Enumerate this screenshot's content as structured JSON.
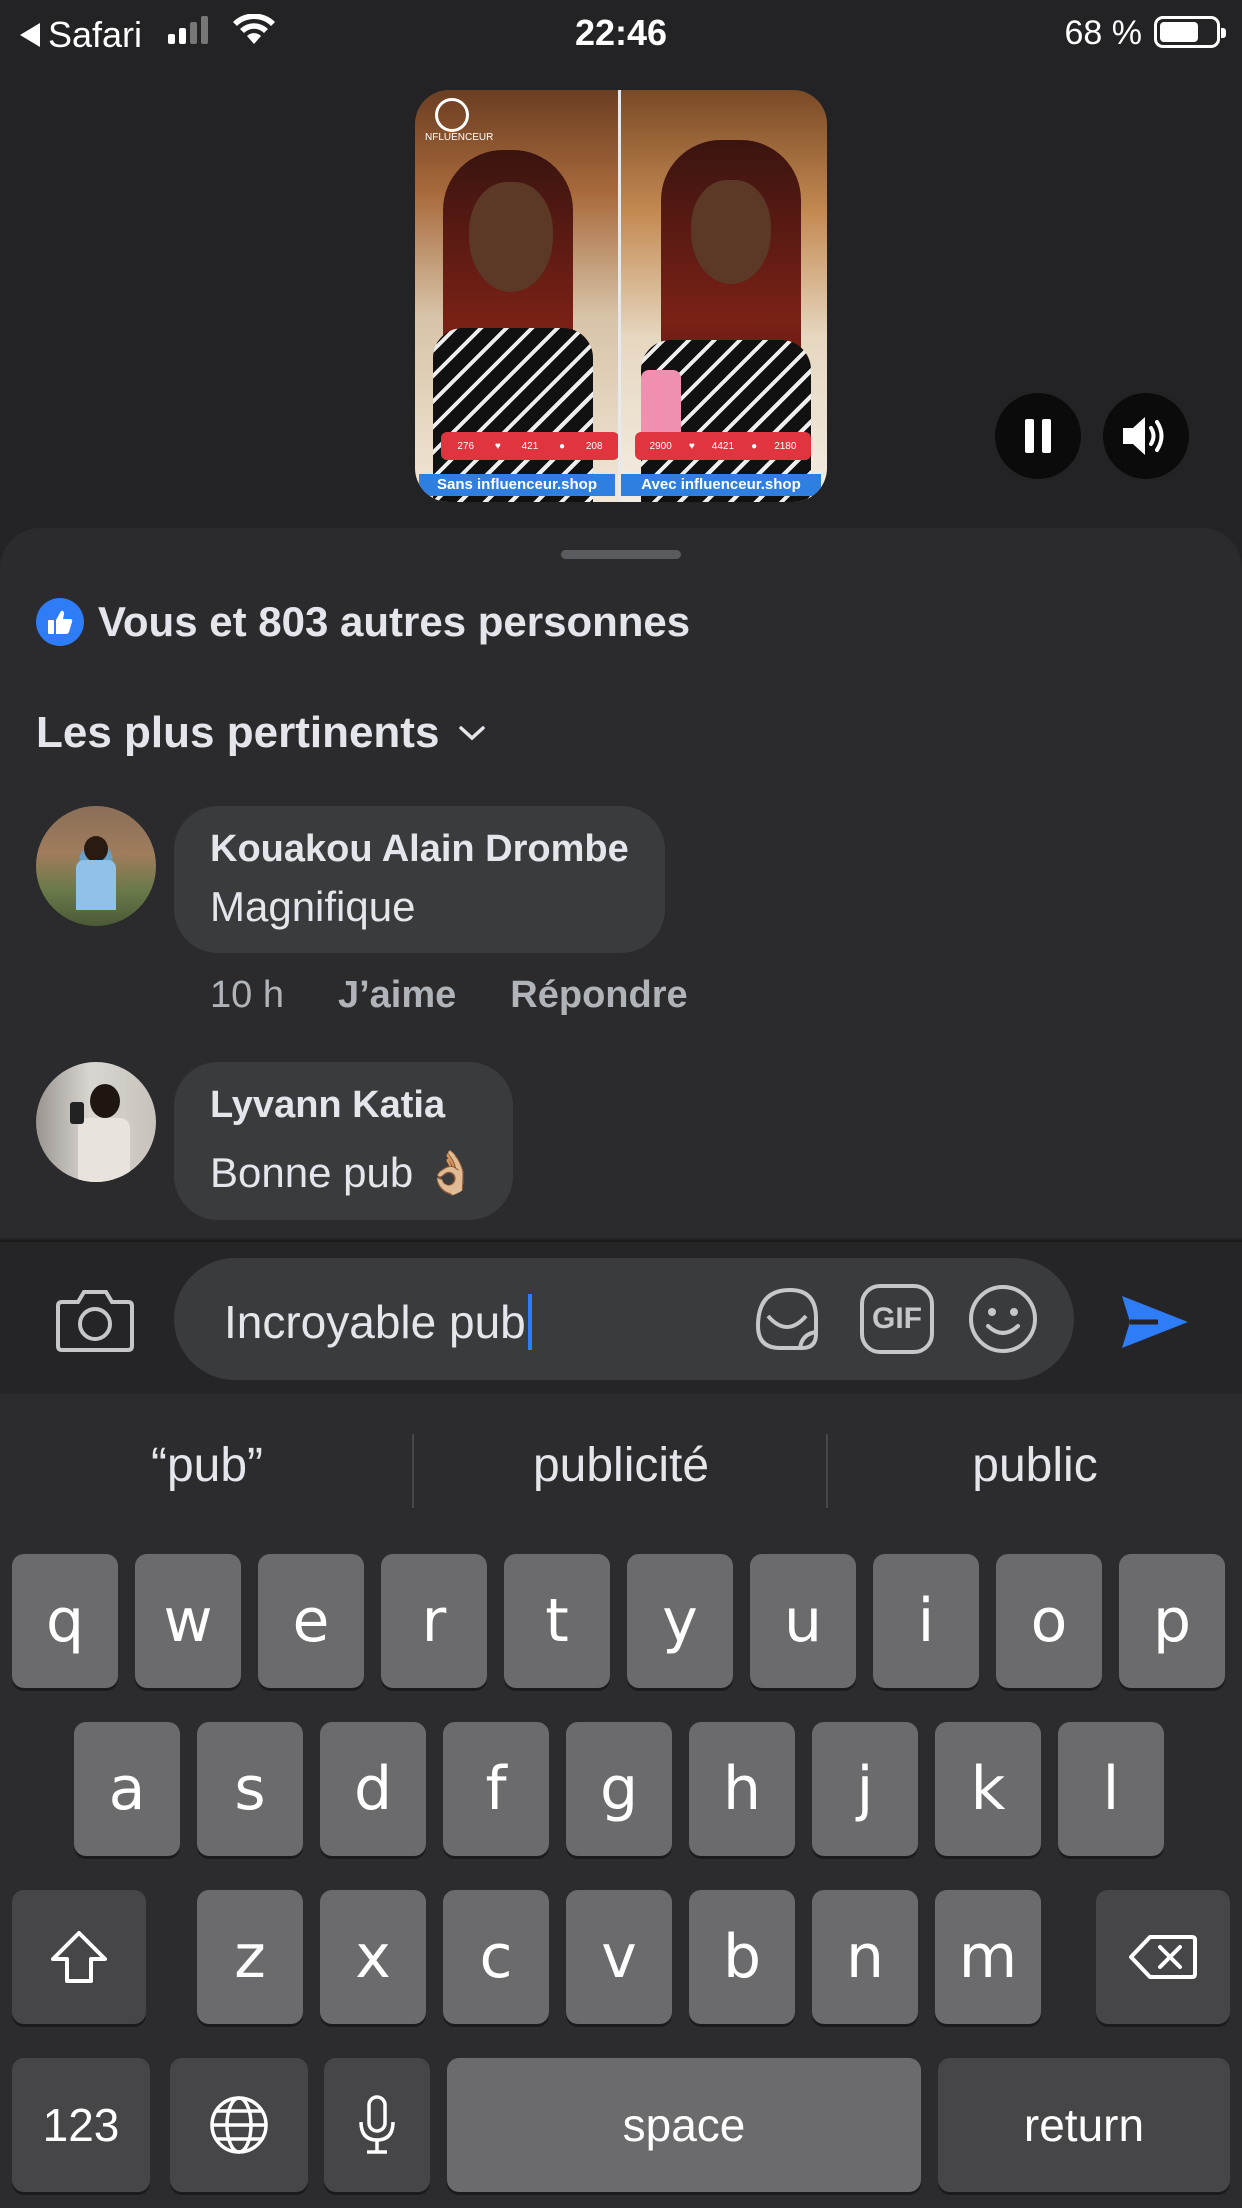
{
  "status_bar": {
    "back_app": "Safari",
    "time": "22:46",
    "battery_percent": "68 %",
    "battery_level": 0.68
  },
  "video": {
    "brand": "NFLUENCEUR",
    "left_caption": "Sans influenceur.shop",
    "right_caption": "Avec influenceur.shop",
    "left_stats": [
      "276",
      "421",
      "208"
    ],
    "right_stats": [
      "2900",
      "4421",
      "2180"
    ],
    "controls": {
      "pause_icon": "pause-icon",
      "volume_icon": "speaker-icon"
    }
  },
  "reactions": {
    "text": "Vous et 803 autres personnes",
    "icon": "thumbs-up-icon",
    "accent": "#2e7cf6"
  },
  "sort": {
    "label": "Les plus pertinents"
  },
  "comments": [
    {
      "name": "Kouakou Alain Drombe",
      "text": "Magnifique",
      "time": "10 h",
      "like": "J’aime",
      "reply": "Répondre"
    },
    {
      "name": "Lyvann Katia",
      "text": "Bonne pub 👌🏼"
    }
  ],
  "composer": {
    "value": "Incroyable pub",
    "icons": [
      "camera-icon",
      "sticker-icon",
      "gif-icon",
      "emoji-icon",
      "send-icon"
    ],
    "gif_label": "GIF"
  },
  "keyboard": {
    "suggestions": [
      "“pub”",
      "publicité",
      "public"
    ],
    "row1": [
      "q",
      "w",
      "e",
      "r",
      "t",
      "y",
      "u",
      "i",
      "o",
      "p"
    ],
    "row2": [
      "a",
      "s",
      "d",
      "f",
      "g",
      "h",
      "j",
      "k",
      "l"
    ],
    "row3": [
      "z",
      "x",
      "c",
      "v",
      "b",
      "n",
      "m"
    ],
    "numbers_label": "123",
    "space_label": "space",
    "return_label": "return"
  }
}
